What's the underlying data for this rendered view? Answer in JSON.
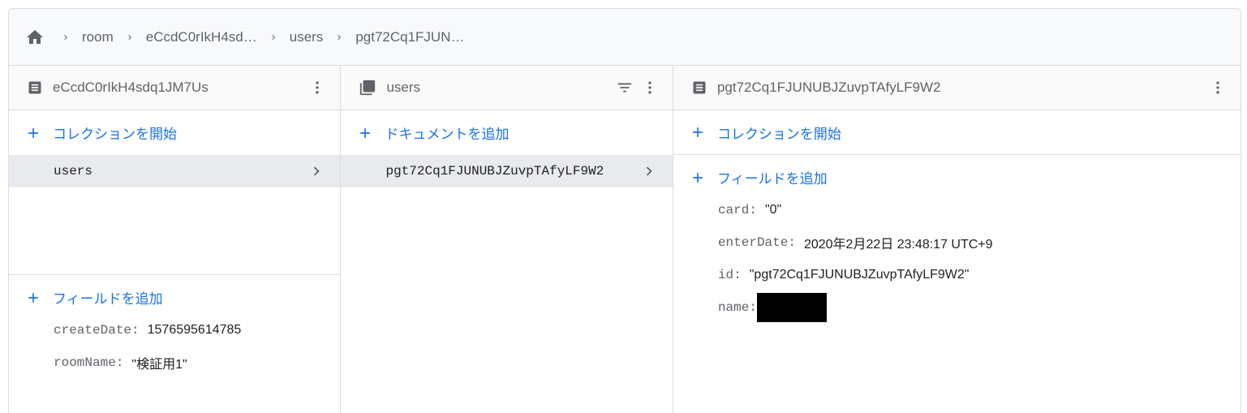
{
  "breadcrumb": {
    "home_icon": "home-icon",
    "items": [
      "room",
      "eCcdC0rIkH4sd…",
      "users",
      "pgt72Cq1FJUN…"
    ]
  },
  "colors": {
    "accent": "#1a73e8",
    "selected": "#e8eaed",
    "border": "#dadce0",
    "redacted": "#000000"
  },
  "columns": {
    "col1": {
      "title": "eCcdC0rIkH4sdq1JM7Us",
      "icon": "document-icon",
      "action": "コレクションを開始",
      "items": [
        "users"
      ],
      "field_action": "フィールドを追加",
      "fields": [
        {
          "key": "createDate:",
          "value": "1576595614785"
        },
        {
          "key": "roomName:",
          "value": "\"検証用1\""
        }
      ]
    },
    "col2": {
      "title": "users",
      "icon": "collection-icon",
      "action": "ドキュメントを追加",
      "items": [
        "pgt72Cq1FJUNUBJZuvpTAfyLF9W2"
      ]
    },
    "col3": {
      "title": "pgt72Cq1FJUNUBJZuvpTAfyLF9W2",
      "icon": "document-icon",
      "action": "コレクションを開始",
      "field_action": "フィールドを追加",
      "fields": [
        {
          "key": "card:",
          "value": "\"0\""
        },
        {
          "key": "enterDate:",
          "value": "2020年2月22日 23:48:17 UTC+9"
        },
        {
          "key": "id:",
          "value": "\"pgt72Cq1FJUNUBJZuvpTAfyLF9W2\""
        },
        {
          "key": "name:",
          "value": ""
        }
      ]
    }
  }
}
